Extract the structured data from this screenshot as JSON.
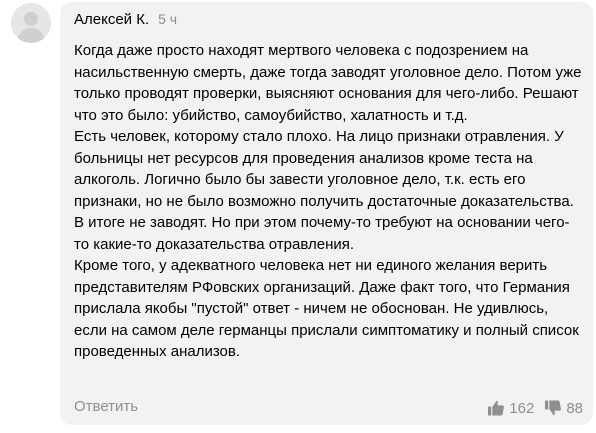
{
  "comment": {
    "author": "Алексей К.",
    "time": "5 ч",
    "paragraphs": [
      "Когда даже просто находят мертвого человека с подозрением на насильственную смерть, даже тогда заводят уголовное дело. Потом уже только проводят проверки, выясняют основания для чего-либо. Решают что это было: убийство, самоубийство, халатность и т.д.",
      "Есть человек, которому стало плохо. На лицо признаки отравления. У больницы нет ресурсов для проведения анализов кроме теста на алкоголь. Логично было бы завести уголовное дело, т.к. есть его признаки, но не было возможно получить достаточные доказательства.",
      "В итоге не заводят. Но при этом почему-то требуют на основании чего-то какие-то доказательства отравления.",
      "Кроме того, у адекватного человека нет ни единого желания верить представителям РФовских организаций. Даже факт того, что Германия прислала якобы \"пустой\" ответ - ничем не обоснован. Не удивлюсь, если на самом деле германцы прислали симптоматику и полный список проведенных анализов."
    ],
    "reply_label": "Ответить",
    "likes": "162",
    "dislikes": "88"
  },
  "icons": {
    "avatar": "user-silhouette-icon",
    "like": "thumbs-up-icon",
    "dislike": "thumbs-down-icon"
  },
  "colors": {
    "bubble_background": "#f2f2f2",
    "muted_text": "#8f8f8f",
    "icon": "#8f8f8f",
    "avatar_background": "#e6e6e6",
    "avatar_figure": "#c8c8c8"
  }
}
